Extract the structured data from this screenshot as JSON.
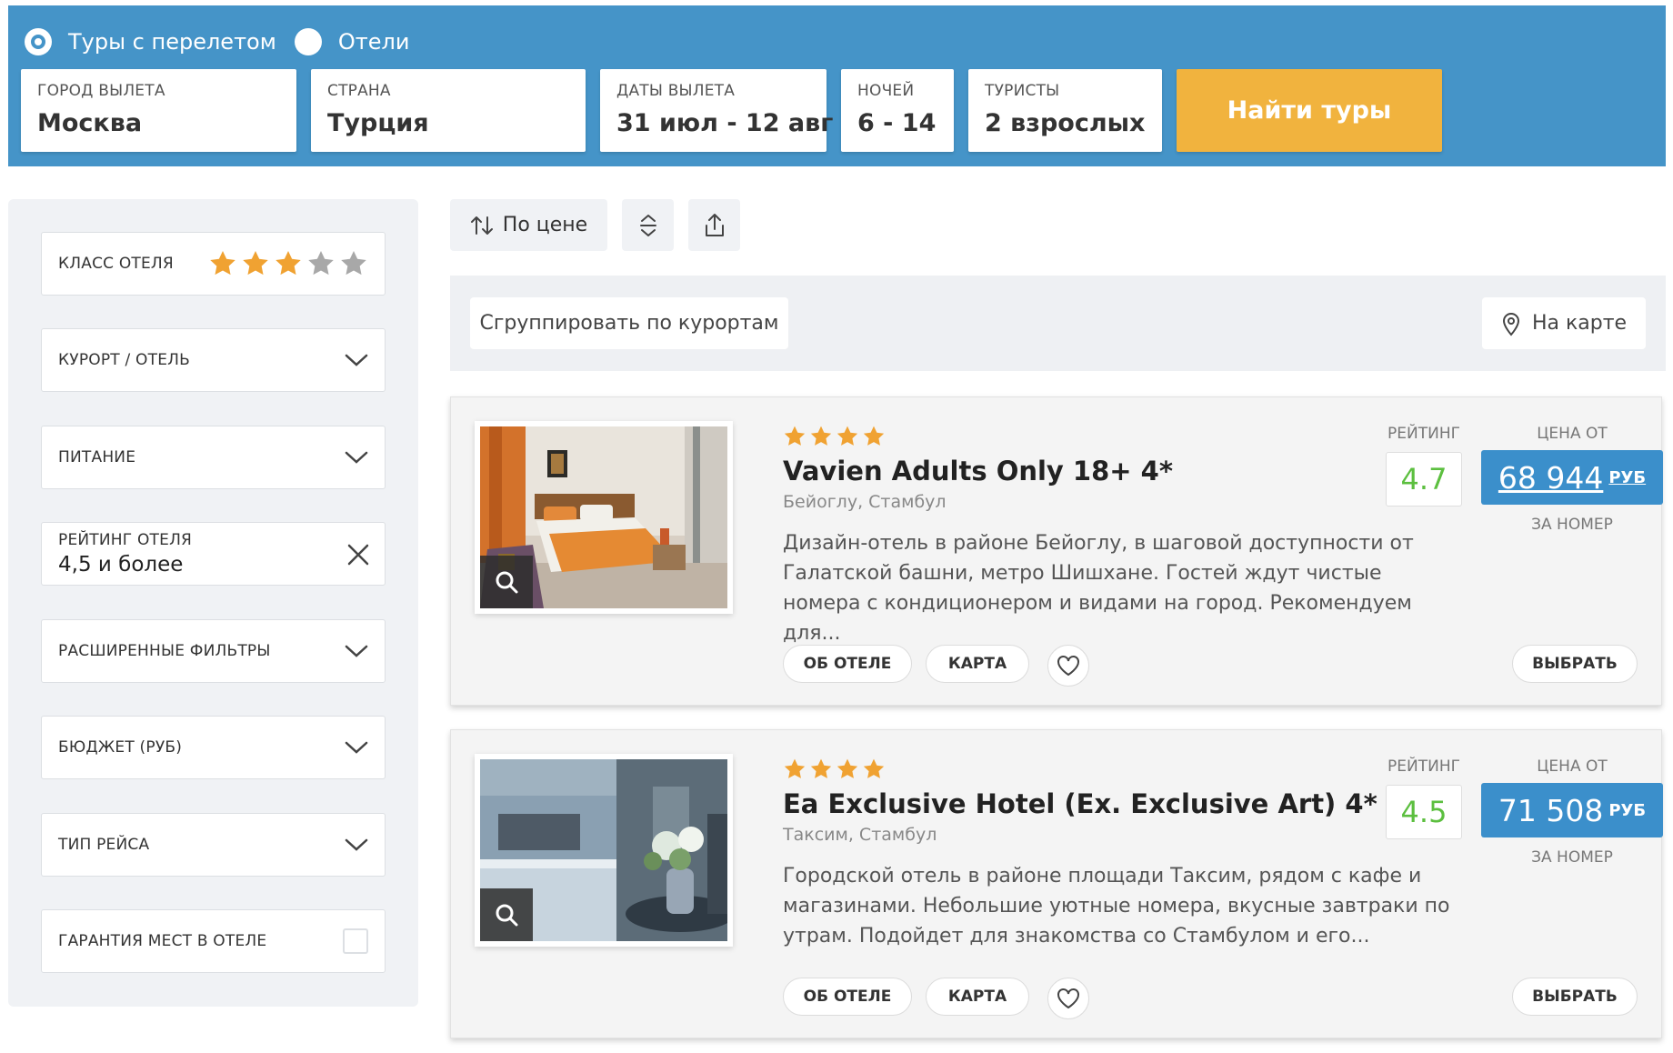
{
  "search": {
    "modes": [
      {
        "label": "Туры с перелетом",
        "checked": true
      },
      {
        "label": "Отели",
        "checked": false
      }
    ],
    "fields": {
      "city": {
        "label": "ГОРОД ВЫЛЕТА",
        "value": "Москва"
      },
      "country": {
        "label": "СТРАНА",
        "value": "Турция"
      },
      "dates": {
        "label": "ДАТЫ ВЫЛЕТА",
        "value": "31 июл - 12 авг"
      },
      "nights": {
        "label": "НОЧЕЙ",
        "value": "6 - 14"
      },
      "tourists": {
        "label": "ТУРИСТЫ",
        "value": "2 взрослых"
      }
    },
    "submit_label": "Найти туры"
  },
  "filters": {
    "hotel_class": {
      "label": "КЛАСС ОТЕЛЯ",
      "stars_selected": 3,
      "stars_total": 5
    },
    "resort": {
      "label": "КУРОРТ / ОТЕЛЬ"
    },
    "meals": {
      "label": "ПИТАНИЕ"
    },
    "rating": {
      "label": "РЕЙТИНГ ОТЕЛЯ",
      "value": "4,5 и более"
    },
    "advanced": {
      "label": "РАСШИРЕННЫЕ ФИЛЬТРЫ"
    },
    "budget": {
      "label": "БЮДЖЕТ (РУБ)"
    },
    "flight_type": {
      "label": "ТИП РЕЙСА"
    },
    "guarantee": {
      "label": "ГАРАНТИЯ МЕСТ В ОТЕЛЕ",
      "checked": false
    }
  },
  "toolbar": {
    "sort_label": "По цене"
  },
  "group_bar": {
    "group_label": "Сгруппировать по курортам",
    "map_label": "На карте"
  },
  "labels": {
    "rating": "РЕЙТИНГ",
    "price_from": "ЦЕНА ОТ",
    "per_room": "ЗА НОМЕР",
    "about": "ОБ ОТЕЛЕ",
    "map": "КАРТА",
    "select": "ВЫБРАТЬ"
  },
  "hotels": [
    {
      "stars": 4,
      "name": "Vavien Adults Only 18+ 4*",
      "location": "Бейоглу, Стамбул",
      "description": "Дизайн-отель в районе Бейоглу, в шаговой доступности от Галатской башни, метро Шишхане. Гостей ждут чистые номера с кондиционером и видами на город. Рекомендуем для...",
      "rating": "4.7",
      "price": "68 944",
      "currency": "РУБ"
    },
    {
      "stars": 4,
      "name": "Ea Exclusive Hotel (Ex. Exclusive Art) 4*",
      "location": "Таксим, Стамбул",
      "description": "Городской отель в районе площади Таксим, рядом с кафе и магазинами. Небольшие уютные номера, вкусные завтраки по утрам. Подойдет для знакомства со Стамбулом и его...",
      "rating": "4.5",
      "price": "71 508",
      "currency": "РУБ"
    }
  ],
  "colors": {
    "header_bg": "#4594c8",
    "accent_button": "#f1b33e",
    "star_active": "#f0a232",
    "star_inactive": "#a8a8a8",
    "price_bg": "#3b8fcb",
    "rating_text": "#5cbf3f"
  }
}
